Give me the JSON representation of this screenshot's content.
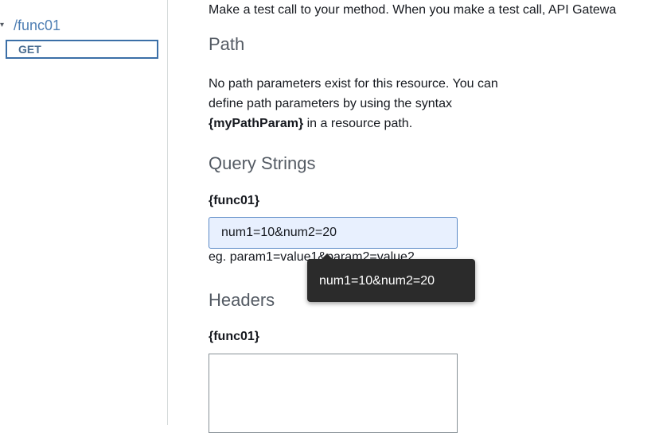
{
  "sidebar": {
    "resource_path": "/func01",
    "method": "GET"
  },
  "main": {
    "intro": "Make a test call to your method. When you make a test call, API Gatewa",
    "path": {
      "title": "Path",
      "desc_before": "No path parameters exist for this resource. You can define path parameters by using the syntax ",
      "desc_bold": "{myPathParam}",
      "desc_after": " in a resource path."
    },
    "query_strings": {
      "title": "Query Strings",
      "field_label": "{func01}",
      "value": "num1=10&num2=20",
      "hint": "eg. param1=value1&param2=value2"
    },
    "headers": {
      "title": "Headers",
      "field_label": "{func01}",
      "value": ""
    }
  },
  "tooltip": {
    "text": "num1=10&num2=20"
  },
  "colors": {
    "link": "#4f7fb4",
    "method_border": "#3b6fa7",
    "input_bg": "#e8f0fe",
    "tooltip_bg": "#2b2b2b"
  }
}
